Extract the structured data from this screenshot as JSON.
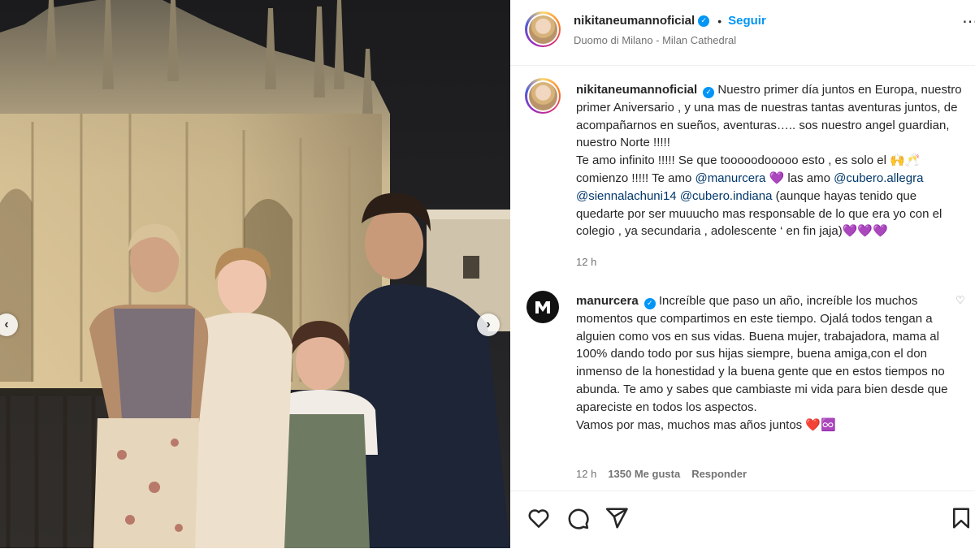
{
  "post": {
    "username": "nikitaneumannoficial",
    "follow_label": "Seguir",
    "dot": "•",
    "location": "Duomo di Milano - Milan Cathedral",
    "more": "⋯"
  },
  "caption": {
    "username": "nikitaneumannoficial",
    "text_1": " Nuestro primer día juntos en Europa, nuestro primer Aniversario , y una mas de nuestras tantas aventuras juntos, de acompañarnos en sueños, aventuras….. sos nuestro angel guardian, nuestro Norte !!!!!",
    "text_2": "Te amo infinito !!!!! Se que tooooodooooo esto , es solo el ",
    "emoji_1": "🙌🥂",
    "text_3": " comienzo !!!!! Te amo ",
    "mention_1": "@manurcera",
    "heart_1": "💜",
    "text_4": " las amo ",
    "mention_2": "@cubero.allegra",
    "mention_3": "@siennalachuni14",
    "mention_4": "@cubero.indiana",
    "text_5": " (aunque hayas tenido que quedarte por ser muuucho mas responsable de lo que era yo con el colegio , ya secundaria , adolescente ‘ en fin jaja)",
    "hearts_end": "💜💜💜",
    "time": "12 h"
  },
  "comment": {
    "username": "manurcera",
    "text_1": " Increíble que paso un año, increíble los muchos momentos que compartimos en este tiempo. Ojalá todos tengan a alguien como vos en sus vidas. Buena mujer, trabajadora, mama al 100% dando todo por sus hijas siempre, buena amiga,con el don inmenso de la honestidad y la buena gente que en estos tiempos no abunda. Te amo y sabes que cambiaste mi vida para bien desde que apareciste en todos los aspectos.",
    "text_2": "Vamos por mas, muchos mas años juntos ",
    "emoji_end": "❤️♾️",
    "time": "12 h",
    "likes": "1350 Me gusta",
    "reply_label": "Responder"
  },
  "icons": {
    "like": "heart-icon",
    "comment": "comment-icon",
    "share": "share-icon",
    "save": "bookmark-icon"
  },
  "colors": {
    "link": "#0095f6",
    "mention": "#00376b",
    "secondary_text": "#737373"
  }
}
